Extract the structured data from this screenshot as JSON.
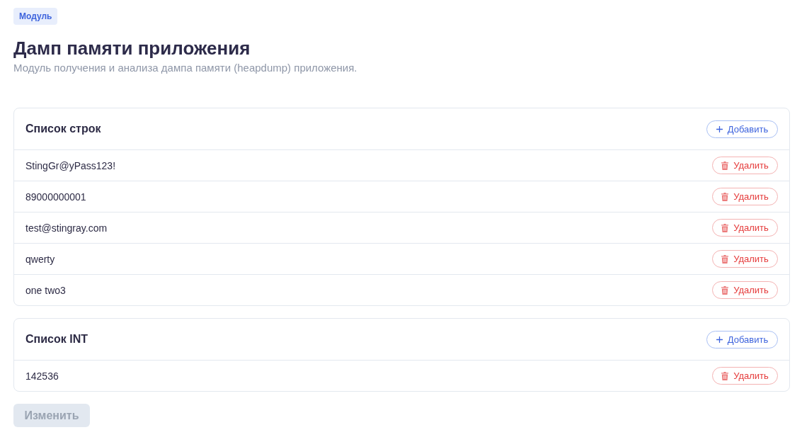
{
  "badge": "Модуль",
  "title": "Дамп памяти приложения",
  "subtitle": "Модуль получения и анализа дампа памяти (heapdump) приложения.",
  "lists": [
    {
      "title": "Список строк",
      "add_button": "Добавить",
      "items": [
        {
          "value": "StingGr@yPass123!",
          "delete_button": "Удалить"
        },
        {
          "value": "89000000001",
          "delete_button": "Удалить"
        },
        {
          "value": "test@stingray.com",
          "delete_button": "Удалить"
        },
        {
          "value": "qwerty",
          "delete_button": "Удалить"
        },
        {
          "value": "one two3",
          "delete_button": "Удалить"
        }
      ]
    },
    {
      "title": "Список INT",
      "add_button": "Добавить",
      "items": [
        {
          "value": "142536",
          "delete_button": "Удалить"
        }
      ]
    }
  ],
  "submit_button": {
    "label": "Изменить",
    "disabled": true
  }
}
